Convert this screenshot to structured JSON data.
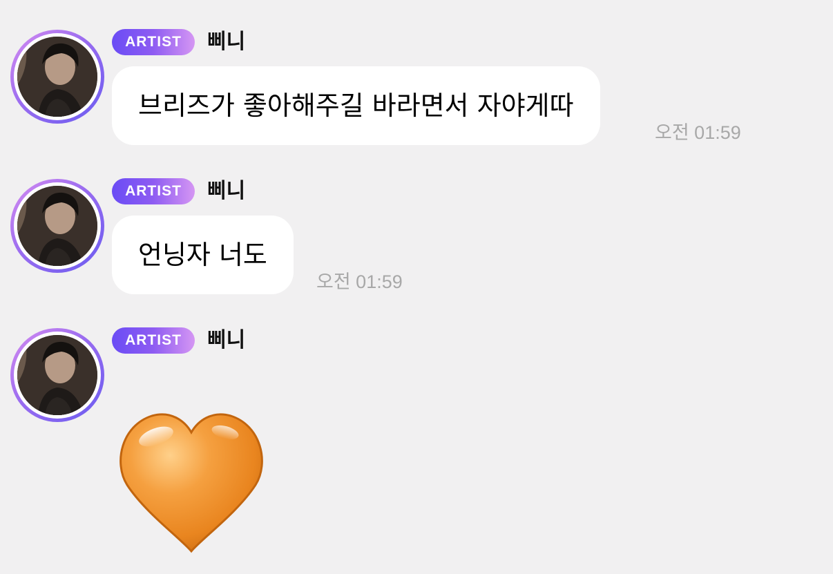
{
  "messages": [
    {
      "badge": "ARTIST",
      "sender": "삐니",
      "text": "브리즈가 좋아해주길 바라면서 자야게따",
      "time": "오전 01:59"
    },
    {
      "badge": "ARTIST",
      "sender": "삐니",
      "text": "언닝자 너도",
      "time": "오전 01:59"
    },
    {
      "badge": "ARTIST",
      "sender": "삐니",
      "emoji": "orange-heart-icon"
    }
  ],
  "colors": {
    "background": "#f1f0f1",
    "bubble": "#ffffff",
    "badge_start": "#6a4cf5",
    "badge_end": "#d596f3",
    "timestamp": "#a8a8a8",
    "heart": "#f0902a"
  }
}
